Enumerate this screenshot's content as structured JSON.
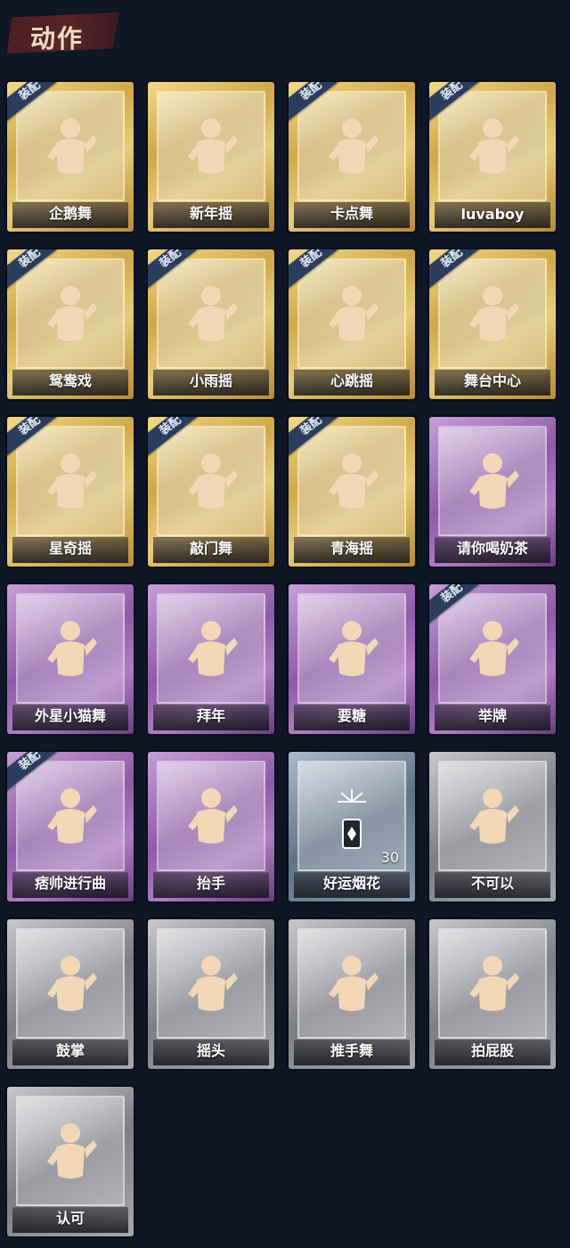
{
  "header": {
    "title": "动作"
  },
  "equipped_label": "装配",
  "colors": {
    "gold": "#d9b65a",
    "purple": "#a06cb8",
    "blue": "#7a8fa3",
    "gray": "#9c9da3"
  },
  "cards": [
    {
      "name": "企鹅舞",
      "rarity": "gold",
      "equipped": true,
      "icon": "dance-pose-icon"
    },
    {
      "name": "新年摇",
      "rarity": "gold",
      "equipped": false,
      "icon": "dance-pose-icon"
    },
    {
      "name": "卡点舞",
      "rarity": "gold",
      "equipped": true,
      "icon": "dance-pose-icon"
    },
    {
      "name": "luvaboy",
      "rarity": "gold",
      "equipped": true,
      "icon": "dance-pose-icon"
    },
    {
      "name": "鸳鸯戏",
      "rarity": "gold",
      "equipped": true,
      "icon": "dance-pose-icon"
    },
    {
      "name": "小雨摇",
      "rarity": "gold",
      "equipped": true,
      "icon": "dance-pose-icon"
    },
    {
      "name": "心跳摇",
      "rarity": "gold",
      "equipped": true,
      "icon": "dance-pose-icon"
    },
    {
      "name": "舞台中心",
      "rarity": "gold",
      "equipped": true,
      "icon": "dance-pose-icon"
    },
    {
      "name": "星奇摇",
      "rarity": "gold",
      "equipped": true,
      "icon": "dance-pose-icon"
    },
    {
      "name": "敲门舞",
      "rarity": "gold",
      "equipped": true,
      "icon": "dance-pose-icon"
    },
    {
      "name": "青海摇",
      "rarity": "gold",
      "equipped": true,
      "icon": "dance-pose-icon"
    },
    {
      "name": "请你喝奶茶",
      "rarity": "purple",
      "equipped": false,
      "icon": "scroll-pose-icon"
    },
    {
      "name": "外星小猫舞",
      "rarity": "purple",
      "equipped": false,
      "icon": "dance-pose-icon"
    },
    {
      "name": "拜年",
      "rarity": "purple",
      "equipped": false,
      "icon": "greeting-pose-icon"
    },
    {
      "name": "要糖",
      "rarity": "purple",
      "equipped": false,
      "icon": "reach-pose-icon"
    },
    {
      "name": "举牌",
      "rarity": "purple",
      "equipped": true,
      "icon": "sign-pose-icon"
    },
    {
      "name": "痞帅进行曲",
      "rarity": "purple",
      "equipped": true,
      "icon": "dance-pose-icon"
    },
    {
      "name": "抬手",
      "rarity": "purple",
      "equipped": false,
      "icon": "raise-hand-icon"
    },
    {
      "name": "好运烟花",
      "rarity": "blue",
      "equipped": false,
      "icon": "firework-icon",
      "count": "30"
    },
    {
      "name": "不可以",
      "rarity": "gray",
      "equipped": false,
      "icon": "finger-wag-icon"
    },
    {
      "name": "鼓掌",
      "rarity": "gray",
      "equipped": false,
      "icon": "clap-icon"
    },
    {
      "name": "摇头",
      "rarity": "gray",
      "equipped": false,
      "icon": "shake-head-icon"
    },
    {
      "name": "推手舞",
      "rarity": "gray",
      "equipped": false,
      "icon": "push-hands-icon"
    },
    {
      "name": "拍屁股",
      "rarity": "gray",
      "equipped": false,
      "icon": "butt-slap-icon"
    },
    {
      "name": "认可",
      "rarity": "gray",
      "equipped": false,
      "icon": "thumbs-up-icon"
    }
  ]
}
